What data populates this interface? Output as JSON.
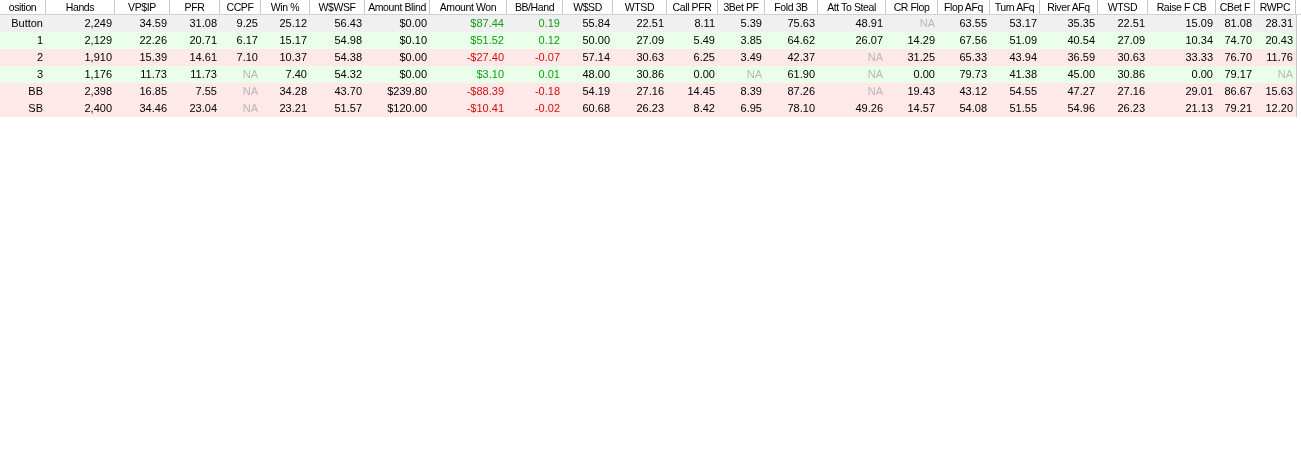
{
  "table": {
    "columns": [
      "osition",
      "Hands",
      "VP$IP",
      "PFR",
      "CCPF",
      "Win %",
      "W$WSF",
      "Amount Blind",
      "Amount Won",
      "BB/Hand",
      "W$SD",
      "WTSD",
      "Call PFR",
      "3Bet PF",
      "Fold 3B",
      "Att To Steal",
      "CR Flop",
      "Flop AFq",
      "Turn AFq",
      "River AFq",
      "WTSD",
      "Raise F CB",
      "CBet F",
      "RWPC"
    ],
    "rows": [
      {
        "selected": true,
        "cells": [
          {
            "text": "Button",
            "kind": "plain"
          },
          {
            "text": "2,249",
            "kind": "plain"
          },
          {
            "text": "34.59",
            "kind": "plain"
          },
          {
            "text": "31.08",
            "kind": "plain"
          },
          {
            "text": "9.25",
            "kind": "plain"
          },
          {
            "text": "25.12",
            "kind": "plain"
          },
          {
            "text": "56.43",
            "kind": "plain"
          },
          {
            "text": "$0.00",
            "kind": "plain"
          },
          {
            "text": "$87.44",
            "kind": "positive"
          },
          {
            "text": "0.19",
            "kind": "positive"
          },
          {
            "text": "55.84",
            "kind": "plain"
          },
          {
            "text": "22.51",
            "kind": "plain"
          },
          {
            "text": "8.11",
            "kind": "plain"
          },
          {
            "text": "5.39",
            "kind": "plain"
          },
          {
            "text": "75.63",
            "kind": "plain"
          },
          {
            "text": "48.91",
            "kind": "plain"
          },
          {
            "text": "NA",
            "kind": "na"
          },
          {
            "text": "63.55",
            "kind": "plain"
          },
          {
            "text": "53.17",
            "kind": "plain"
          },
          {
            "text": "35.35",
            "kind": "plain"
          },
          {
            "text": "22.51",
            "kind": "plain"
          },
          {
            "text": "15.09",
            "kind": "plain"
          },
          {
            "text": "81.08",
            "kind": "plain"
          },
          {
            "text": "28.31",
            "kind": "plain"
          }
        ]
      },
      {
        "selected": false,
        "color": "#eaffea",
        "cells": [
          {
            "text": "1",
            "kind": "plain"
          },
          {
            "text": "2,129",
            "kind": "plain"
          },
          {
            "text": "22.26",
            "kind": "plain"
          },
          {
            "text": "20.71",
            "kind": "plain"
          },
          {
            "text": "6.17",
            "kind": "plain"
          },
          {
            "text": "15.17",
            "kind": "plain"
          },
          {
            "text": "54.98",
            "kind": "plain"
          },
          {
            "text": "$0.10",
            "kind": "plain"
          },
          {
            "text": "$51.52",
            "kind": "positive"
          },
          {
            "text": "0.12",
            "kind": "positive"
          },
          {
            "text": "50.00",
            "kind": "plain"
          },
          {
            "text": "27.09",
            "kind": "plain"
          },
          {
            "text": "5.49",
            "kind": "plain"
          },
          {
            "text": "3.85",
            "kind": "plain"
          },
          {
            "text": "64.62",
            "kind": "plain"
          },
          {
            "text": "26.07",
            "kind": "plain"
          },
          {
            "text": "14.29",
            "kind": "plain"
          },
          {
            "text": "67.56",
            "kind": "plain"
          },
          {
            "text": "51.09",
            "kind": "plain"
          },
          {
            "text": "40.54",
            "kind": "plain"
          },
          {
            "text": "27.09",
            "kind": "plain"
          },
          {
            "text": "10.34",
            "kind": "plain"
          },
          {
            "text": "74.70",
            "kind": "plain"
          },
          {
            "text": "20.43",
            "kind": "plain"
          }
        ]
      },
      {
        "selected": false,
        "color": "#ffe8e8",
        "cells": [
          {
            "text": "2",
            "kind": "plain"
          },
          {
            "text": "1,910",
            "kind": "plain"
          },
          {
            "text": "15.39",
            "kind": "plain"
          },
          {
            "text": "14.61",
            "kind": "plain"
          },
          {
            "text": "7.10",
            "kind": "plain"
          },
          {
            "text": "10.37",
            "kind": "plain"
          },
          {
            "text": "54.38",
            "kind": "plain"
          },
          {
            "text": "$0.00",
            "kind": "plain"
          },
          {
            "text": "-$27.40",
            "kind": "negative"
          },
          {
            "text": "-0.07",
            "kind": "negative"
          },
          {
            "text": "57.14",
            "kind": "plain"
          },
          {
            "text": "30.63",
            "kind": "plain"
          },
          {
            "text": "6.25",
            "kind": "plain"
          },
          {
            "text": "3.49",
            "kind": "plain"
          },
          {
            "text": "42.37",
            "kind": "plain"
          },
          {
            "text": "NA",
            "kind": "na"
          },
          {
            "text": "31.25",
            "kind": "plain"
          },
          {
            "text": "65.33",
            "kind": "plain"
          },
          {
            "text": "43.94",
            "kind": "plain"
          },
          {
            "text": "36.59",
            "kind": "plain"
          },
          {
            "text": "30.63",
            "kind": "plain"
          },
          {
            "text": "33.33",
            "kind": "plain"
          },
          {
            "text": "76.70",
            "kind": "plain"
          },
          {
            "text": "11.76",
            "kind": "plain"
          }
        ]
      },
      {
        "selected": false,
        "color": "#eaffea",
        "cells": [
          {
            "text": "3",
            "kind": "plain"
          },
          {
            "text": "1,176",
            "kind": "plain"
          },
          {
            "text": "11.73",
            "kind": "plain"
          },
          {
            "text": "11.73",
            "kind": "plain"
          },
          {
            "text": "NA",
            "kind": "na"
          },
          {
            "text": "7.40",
            "kind": "plain"
          },
          {
            "text": "54.32",
            "kind": "plain"
          },
          {
            "text": "$0.00",
            "kind": "plain"
          },
          {
            "text": "$3.10",
            "kind": "positive"
          },
          {
            "text": "0.01",
            "kind": "positive"
          },
          {
            "text": "48.00",
            "kind": "plain"
          },
          {
            "text": "30.86",
            "kind": "plain"
          },
          {
            "text": "0.00",
            "kind": "plain"
          },
          {
            "text": "NA",
            "kind": "na"
          },
          {
            "text": "61.90",
            "kind": "plain"
          },
          {
            "text": "NA",
            "kind": "na"
          },
          {
            "text": "0.00",
            "kind": "plain"
          },
          {
            "text": "79.73",
            "kind": "plain"
          },
          {
            "text": "41.38",
            "kind": "plain"
          },
          {
            "text": "45.00",
            "kind": "plain"
          },
          {
            "text": "30.86",
            "kind": "plain"
          },
          {
            "text": "0.00",
            "kind": "plain"
          },
          {
            "text": "79.17",
            "kind": "plain"
          },
          {
            "text": "NA",
            "kind": "na"
          }
        ]
      },
      {
        "selected": false,
        "color": "#ffe8e8",
        "cells": [
          {
            "text": "BB",
            "kind": "plain"
          },
          {
            "text": "2,398",
            "kind": "plain"
          },
          {
            "text": "16.85",
            "kind": "plain"
          },
          {
            "text": "7.55",
            "kind": "plain"
          },
          {
            "text": "NA",
            "kind": "na"
          },
          {
            "text": "34.28",
            "kind": "plain"
          },
          {
            "text": "43.70",
            "kind": "plain"
          },
          {
            "text": "$239.80",
            "kind": "plain"
          },
          {
            "text": "-$88.39",
            "kind": "negative"
          },
          {
            "text": "-0.18",
            "kind": "negative"
          },
          {
            "text": "54.19",
            "kind": "plain"
          },
          {
            "text": "27.16",
            "kind": "plain"
          },
          {
            "text": "14.45",
            "kind": "plain"
          },
          {
            "text": "8.39",
            "kind": "plain"
          },
          {
            "text": "87.26",
            "kind": "plain"
          },
          {
            "text": "NA",
            "kind": "na"
          },
          {
            "text": "19.43",
            "kind": "plain"
          },
          {
            "text": "43.12",
            "kind": "plain"
          },
          {
            "text": "54.55",
            "kind": "plain"
          },
          {
            "text": "47.27",
            "kind": "plain"
          },
          {
            "text": "27.16",
            "kind": "plain"
          },
          {
            "text": "29.01",
            "kind": "plain"
          },
          {
            "text": "86.67",
            "kind": "plain"
          },
          {
            "text": "15.63",
            "kind": "plain"
          }
        ]
      },
      {
        "selected": false,
        "color": "#ffe8e8",
        "cells": [
          {
            "text": "SB",
            "kind": "plain"
          },
          {
            "text": "2,400",
            "kind": "plain"
          },
          {
            "text": "34.46",
            "kind": "plain"
          },
          {
            "text": "23.04",
            "kind": "plain"
          },
          {
            "text": "NA",
            "kind": "na"
          },
          {
            "text": "23.21",
            "kind": "plain"
          },
          {
            "text": "51.57",
            "kind": "plain"
          },
          {
            "text": "$120.00",
            "kind": "plain"
          },
          {
            "text": "-$10.41",
            "kind": "negative"
          },
          {
            "text": "-0.02",
            "kind": "negative"
          },
          {
            "text": "60.68",
            "kind": "plain"
          },
          {
            "text": "26.23",
            "kind": "plain"
          },
          {
            "text": "8.42",
            "kind": "plain"
          },
          {
            "text": "6.95",
            "kind": "plain"
          },
          {
            "text": "78.10",
            "kind": "plain"
          },
          {
            "text": "49.26",
            "kind": "plain"
          },
          {
            "text": "14.57",
            "kind": "plain"
          },
          {
            "text": "54.08",
            "kind": "plain"
          },
          {
            "text": "51.55",
            "kind": "plain"
          },
          {
            "text": "54.96",
            "kind": "plain"
          },
          {
            "text": "26.23",
            "kind": "plain"
          },
          {
            "text": "21.13",
            "kind": "plain"
          },
          {
            "text": "79.21",
            "kind": "plain"
          },
          {
            "text": "12.20",
            "kind": "plain"
          }
        ]
      }
    ]
  }
}
